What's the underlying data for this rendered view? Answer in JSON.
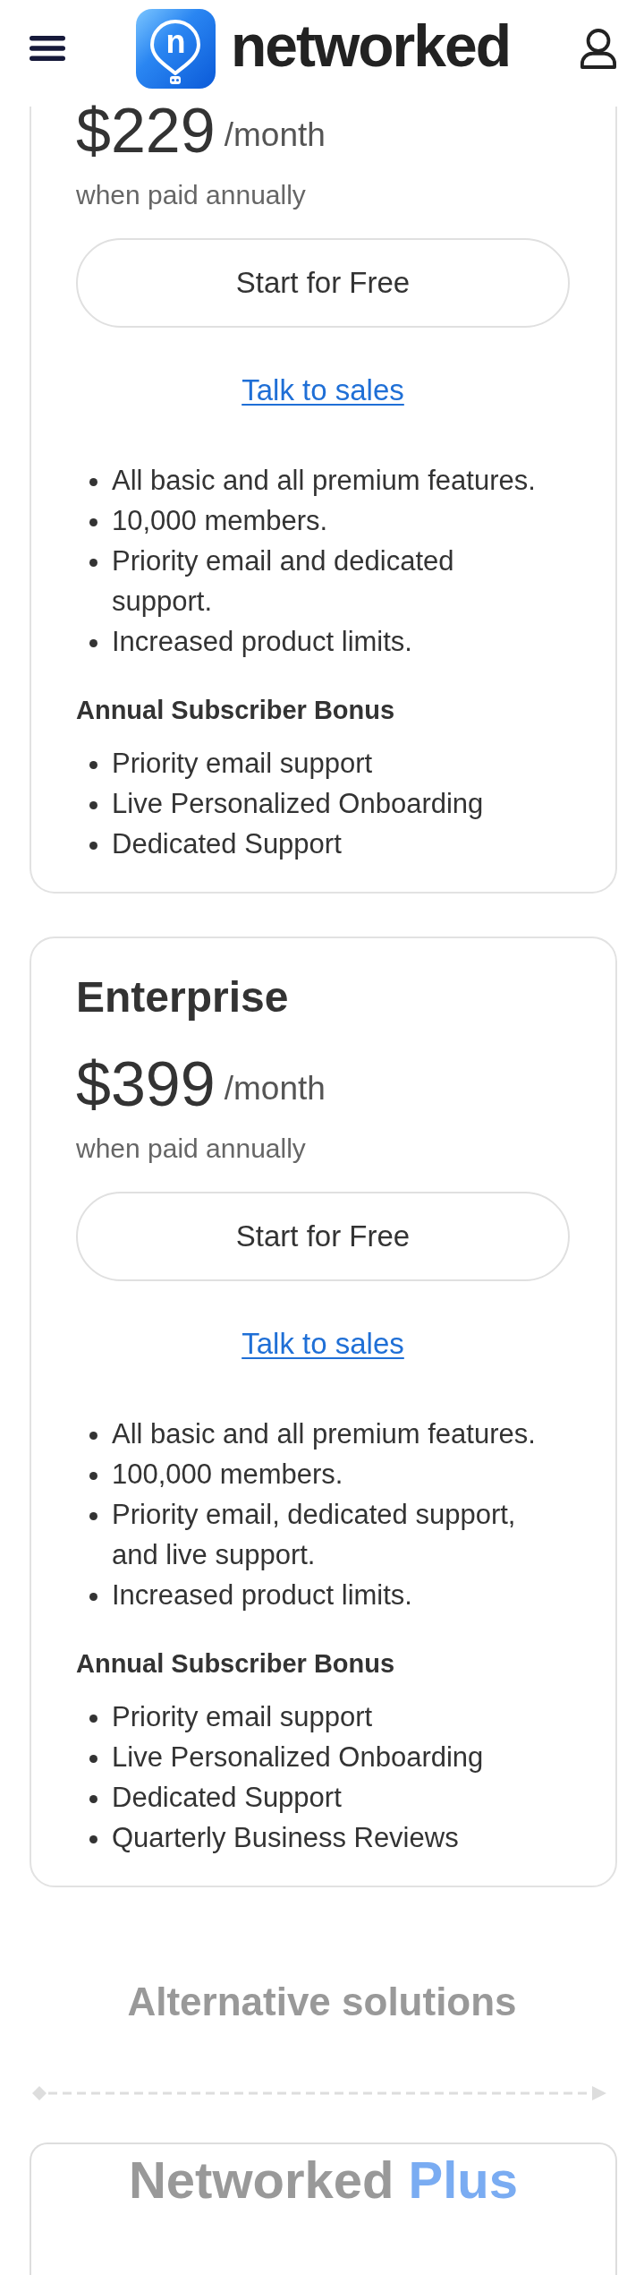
{
  "header": {
    "logo_letter": "n",
    "wordmark": "networked"
  },
  "plans": [
    {
      "price": "$229",
      "period": "/month",
      "billing_note": "when paid annually",
      "cta": "Start for Free",
      "sales_link": "Talk to sales",
      "features": [
        "All basic and all premium features.",
        "10,000 members.",
        "Priority email and dedicated support.",
        "Increased product limits."
      ],
      "bonus_title": "Annual Subscriber Bonus",
      "bonus": [
        "Priority email support",
        "Live Personalized Onboarding",
        "Dedicated Support"
      ]
    },
    {
      "name": "Enterprise",
      "price": "$399",
      "period": "/month",
      "billing_note": "when paid annually",
      "cta": "Start for Free",
      "sales_link": "Talk to sales",
      "features": [
        "All basic and all premium features.",
        "100,000 members.",
        "Priority email, dedicated support, and live support.",
        "Increased product limits."
      ],
      "bonus_title": "Annual Subscriber Bonus",
      "bonus": [
        "Priority email support",
        "Live Personalized Onboarding",
        "Dedicated Support",
        "Quarterly Business Reviews"
      ]
    }
  ],
  "alternatives": {
    "title": "Alternative solutions",
    "products": [
      {
        "title_parts": [
          {
            "text": "Networked",
            "accent": false
          },
          {
            "text": "Plus",
            "accent": true
          }
        ]
      }
    ]
  }
}
